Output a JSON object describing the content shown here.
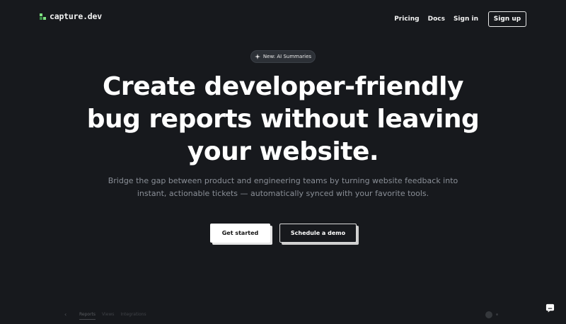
{
  "header": {
    "brand": "capture.dev",
    "nav": {
      "pricing": "Pricing",
      "docs": "Docs",
      "sign_in": "Sign in",
      "sign_up": "Sign up"
    }
  },
  "hero": {
    "badge": "New: AI Summaries",
    "headline_lines": [
      "Create developer-friendly",
      "bug reports without leaving",
      "your website."
    ],
    "subhead_lines": [
      "Bridge the gap between product and engineering teams by turning website feedback into",
      "instant, actionable tickets — automatically synced with your favorite tools."
    ],
    "cta_primary": "Get started",
    "cta_secondary": "Schedule a demo"
  },
  "preview": {
    "tabs": [
      "Reports",
      "Views",
      "Integrations"
    ]
  },
  "colors": {
    "background": "#17191d",
    "brand_accent": "#7ee081",
    "subtext": "#8a8f97"
  },
  "icons": {
    "logo": "logo-icon",
    "badge": "sparkle-icon",
    "chat": "chat-icon",
    "back": "chevron-left-icon"
  }
}
